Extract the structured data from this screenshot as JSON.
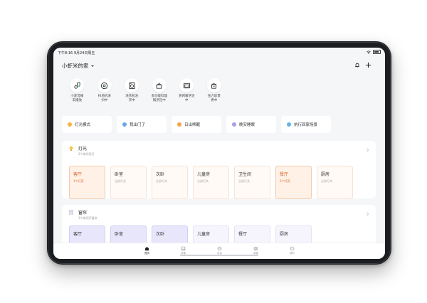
{
  "status_bar": {
    "time": "下午8:16 9月24日周五"
  },
  "header": {
    "home_name": "小虾米的家"
  },
  "devices": [
    {
      "label_line1": "小爱音箱",
      "label_line2": "未播放",
      "icon": "speaker-icon"
    },
    {
      "label_line1": "扫地机清",
      "label_line2": "扫中",
      "icon": "robot-vacuum-icon"
    },
    {
      "label_line1": "洗衣机洗",
      "label_line2": "衣中",
      "icon": "washing-machine-icon"
    },
    {
      "label_line1": "多功能料理",
      "label_line2": "锅烹饪中",
      "icon": "cooker-icon"
    },
    {
      "label_line1": "蒸烤箱烹饪",
      "label_line2": "中",
      "icon": "oven-icon"
    },
    {
      "label_line1": "压力饭煲",
      "label_line2": "煮中",
      "icon": "rice-cooker-icon"
    }
  ],
  "scenes": [
    {
      "label": "灯光模式",
      "color": "#f5b342"
    },
    {
      "label": "我出门了",
      "color": "#6aa6e8"
    },
    {
      "label": "日出唤醒",
      "color": "#f0a64a"
    },
    {
      "label": "晚安睡眠",
      "color": "#a89de6"
    },
    {
      "label": "执行回家场景",
      "color": "#5fb6e0"
    }
  ],
  "lights": {
    "title": "灯光",
    "subtitle": "2个房间亮灯",
    "rooms": [
      {
        "name": "客厅",
        "status": "1个灯亮",
        "state": "on"
      },
      {
        "name": "卧室",
        "status": "全部灯关",
        "state": "off"
      },
      {
        "name": "次卧",
        "status": "全部灯关",
        "state": "off"
      },
      {
        "name": "儿童房",
        "status": "全部灯关",
        "state": "off"
      },
      {
        "name": "卫生间",
        "status": "全部灯关",
        "state": "off"
      },
      {
        "name": "餐厅",
        "status": "2个灯亮",
        "state": "on"
      },
      {
        "name": "厨房",
        "status": "全部灯关",
        "state": "off"
      }
    ]
  },
  "curtains": {
    "title": "窗帘",
    "subtitle": "3个房间开窗帘",
    "rooms": [
      {
        "name": "客厅",
        "state": "purple"
      },
      {
        "name": "卧室",
        "state": "purple"
      },
      {
        "name": "次卧",
        "state": "purple"
      },
      {
        "name": "儿童房",
        "state": "lilac"
      },
      {
        "name": "餐厅",
        "state": "lilac"
      },
      {
        "name": "厨房",
        "state": "lilac"
      }
    ]
  },
  "tabbar": {
    "items": [
      {
        "label": "首页",
        "active": true
      },
      {
        "label": "设备",
        "active": false
      },
      {
        "label": "自动",
        "active": false
      },
      {
        "label": "商城",
        "active": false
      },
      {
        "label": "我的",
        "active": false
      }
    ]
  },
  "colors": {
    "accent_orange": "#d4632a",
    "device_frame": "#1b1d20",
    "screen_bg": "#f5f6f8"
  }
}
